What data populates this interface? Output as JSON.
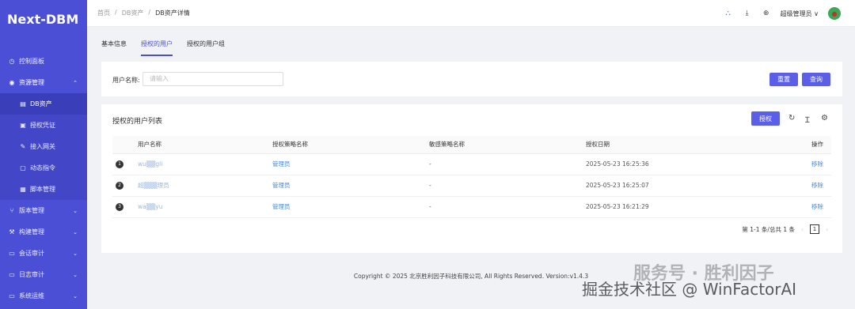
{
  "app": {
    "logo": "Next-DBM"
  },
  "sidebar": {
    "items": [
      {
        "label": "控制面板",
        "icon": "◷",
        "chev": ""
      },
      {
        "label": "资源管理",
        "icon": "◉",
        "chev": "⌃"
      },
      {
        "label": "DB资产",
        "icon": "▤",
        "chev": ""
      },
      {
        "label": "授权凭证",
        "icon": "▣",
        "chev": ""
      },
      {
        "label": "接入网关",
        "icon": "✎",
        "chev": ""
      },
      {
        "label": "动态指令",
        "icon": "▢",
        "chev": ""
      },
      {
        "label": "脚本管理",
        "icon": "▦",
        "chev": ""
      },
      {
        "label": "版本管理",
        "icon": "⑂",
        "chev": "⌄"
      },
      {
        "label": "构建管理",
        "icon": "⚒",
        "chev": "⌄"
      },
      {
        "label": "会话审计",
        "icon": "▭",
        "chev": "⌄"
      },
      {
        "label": "日志审计",
        "icon": "▭",
        "chev": "⌄"
      },
      {
        "label": "系统运维",
        "icon": "▭",
        "chev": "⌄"
      }
    ]
  },
  "breadcrumb": {
    "home": "首页",
    "sep": "/",
    "level1": "DB资产",
    "current": "DB资产详情"
  },
  "header": {
    "icon1": "⛬",
    "icon2": "⤓",
    "icon3": "⊕",
    "user": "超级管理员",
    "user_chev": "∨"
  },
  "tabs": [
    "基本信息",
    "授权的用户",
    "授权的用户组"
  ],
  "search": {
    "label": "用户名称:",
    "placeholder": "请输入",
    "reset": "重置",
    "query": "查询"
  },
  "list": {
    "title": "授权的用户列表",
    "authorize": "授权",
    "columns": [
      "用户名称",
      "授权策略名称",
      "敏感策略名称",
      "授权日期",
      "操作"
    ],
    "rows": [
      {
        "idx": "1",
        "user": "wu▒▒gli",
        "strategy": "管理员",
        "sensitive": "-",
        "date": "2025-05-23 16:25:36",
        "action": "移除"
      },
      {
        "idx": "2",
        "user": "超▒▒▒理员",
        "strategy": "管理员",
        "sensitive": "-",
        "date": "2025-05-23 16:25:07",
        "action": "移除"
      },
      {
        "idx": "3",
        "user": "wa▒▒yu",
        "strategy": "管理员",
        "sensitive": "-",
        "date": "2025-05-23 16:21:29",
        "action": "移除"
      }
    ],
    "pagination": {
      "summary": "第 1-1 条/总共 1 条",
      "page": "1",
      "prev": "‹",
      "next": "›"
    }
  },
  "footer": "Copyright © 2025 北京胜利因子科技有限公司, All Rights Reserved. Version:v1.4.3",
  "watermark": {
    "line1": "服务号 · 胜利因子",
    "line2": "掘金技术社区 @ WinFactorAI"
  }
}
